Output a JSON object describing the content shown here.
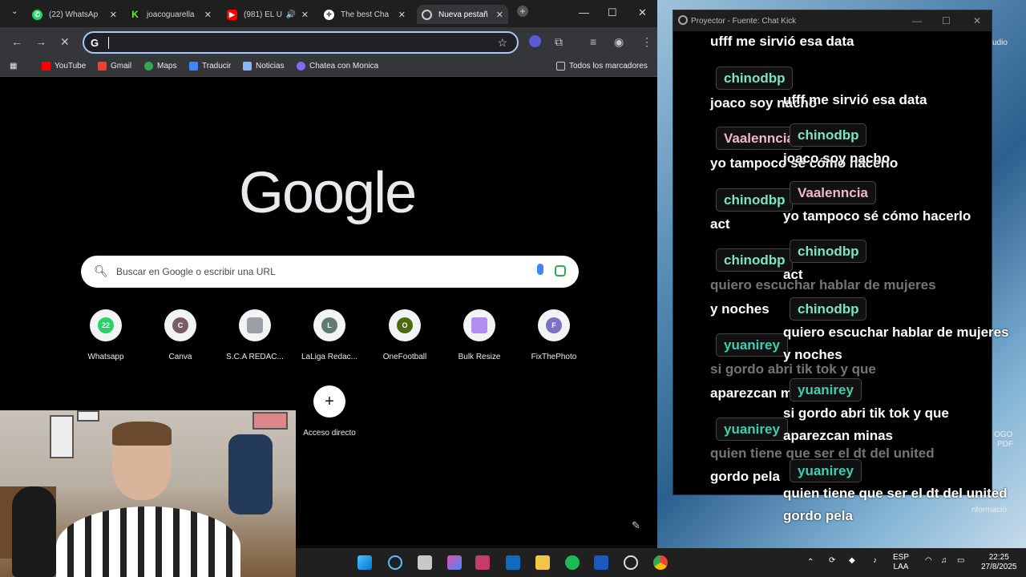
{
  "colors": {
    "accent": "#a8c7fa",
    "green_user": "#7be3c6",
    "pink_user": "#f5b5cf",
    "teal_user": "#3ccfb0"
  },
  "tabs": [
    {
      "label": "(22) WhatsAp",
      "icon": "whatsapp-icon"
    },
    {
      "label": "joacoguarella",
      "icon": "kick-icon"
    },
    {
      "label": "(981) EL U",
      "icon": "youtube-icon"
    },
    {
      "label": "The best Cha",
      "icon": "openai-icon"
    },
    {
      "label": "Nueva pestañ",
      "icon": "chrome-icon"
    }
  ],
  "bookmarks": [
    {
      "label": "YouTube"
    },
    {
      "label": "Gmail"
    },
    {
      "label": "Maps"
    },
    {
      "label": "Traducir"
    },
    {
      "label": "Noticias"
    },
    {
      "label": "Chatea con Monica"
    },
    {
      "label": "Todos los marcadores"
    }
  ],
  "newtab": {
    "logo": "Google",
    "search_placeholder": "Buscar en Google o escribir una URL",
    "shortcuts": [
      {
        "label": "Whatsapp",
        "badge": "22"
      },
      {
        "label": "Canva",
        "badge": "C"
      },
      {
        "label": "S.C.A REDAC...",
        "badge": ""
      },
      {
        "label": "LaLiga Redac...",
        "badge": "L"
      },
      {
        "label": "OneFootball",
        "badge": "O"
      },
      {
        "label": "Bulk Resize",
        "badge": ""
      },
      {
        "label": "FixThePhoto",
        "badge": "F"
      }
    ],
    "add_shortcut": "Acceso directo"
  },
  "projector": {
    "title": "Proyector - Fuente: Chat Kick"
  },
  "chat": {
    "back": [
      {
        "type": "msg",
        "text": "ufff me sirvió esa data"
      },
      {
        "type": "user",
        "text": "chinodbp"
      },
      {
        "type": "msg",
        "text": "joaco soy nacho"
      },
      {
        "type": "user",
        "text": "Vaalenncia"
      },
      {
        "type": "msg",
        "text": "yo tampoco sé cómo hacerlo"
      },
      {
        "type": "user",
        "text": "chinodbp"
      },
      {
        "type": "msg",
        "text": "act"
      },
      {
        "type": "user",
        "text": "chinodbp"
      },
      {
        "type": "msg",
        "text": "quiero escuchar hablar de mujeres"
      },
      {
        "type": "msg",
        "text": "y noches"
      },
      {
        "type": "user",
        "text": "yuanirey"
      },
      {
        "type": "msg",
        "text": "si gordo abri tik tok y que"
      },
      {
        "type": "msg",
        "text": "aparezcan minas"
      },
      {
        "type": "user",
        "text": "yuanirey"
      },
      {
        "type": "msg",
        "text": "quien tiene que ser el dt del united"
      },
      {
        "type": "msg",
        "text": "gordo pela"
      }
    ],
    "front": [
      {
        "type": "msg",
        "text": "ufff me sirvió esa data"
      },
      {
        "type": "user",
        "text": "chinodbp"
      },
      {
        "type": "msg",
        "text": "joaco soy nacho"
      },
      {
        "type": "user",
        "text": "Vaalenncia"
      },
      {
        "type": "msg",
        "text": "yo tampoco sé cómo hacerlo"
      },
      {
        "type": "user",
        "text": "chinodbp"
      },
      {
        "type": "msg",
        "text": "act"
      },
      {
        "type": "user",
        "text": "chinodbp"
      },
      {
        "type": "msg",
        "text": "quiero escuchar hablar de mujeres"
      },
      {
        "type": "msg",
        "text": "y noches"
      },
      {
        "type": "user",
        "text": "yuanirey"
      },
      {
        "type": "msg",
        "text": "si gordo abri tik tok y que"
      },
      {
        "type": "msg",
        "text": "aparezcan minas"
      },
      {
        "type": "user",
        "text": "yuanirey"
      },
      {
        "type": "msg",
        "text": "quien tiene que ser el dt del united"
      },
      {
        "type": "msg",
        "text": "gordo pela"
      }
    ]
  },
  "desktop": {
    "labels": [
      "udio",
      "OGO",
      "PDF",
      "nformació"
    ]
  },
  "taskbar": {
    "lang": "ESP",
    "layout": "LAA",
    "time": "22:25",
    "date": "27/8/2025"
  }
}
